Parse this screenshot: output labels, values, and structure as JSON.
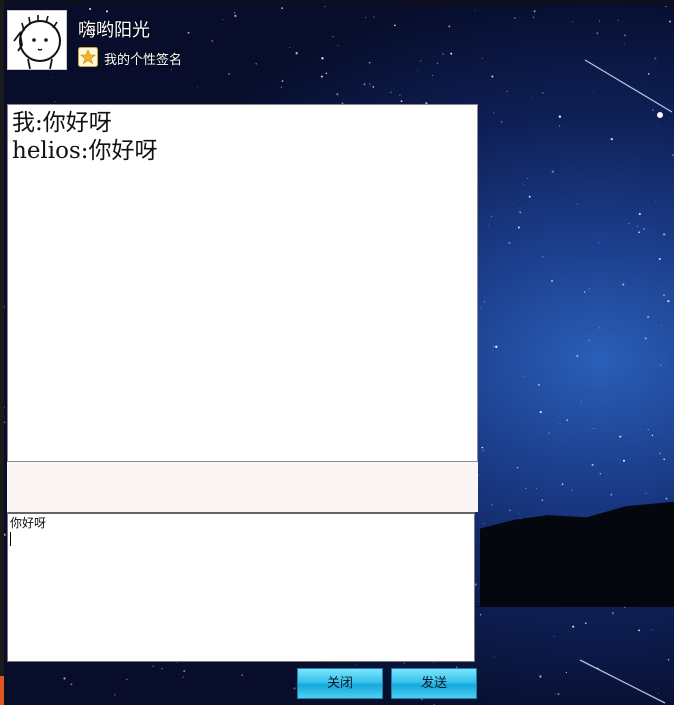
{
  "header": {
    "nickname": "嗨哟阳光",
    "signature": "我的个性签名",
    "avatar_icon": "cartoon-avatar-icon",
    "signature_icon": "star-icon"
  },
  "chat": {
    "messages": [
      {
        "sender": "我",
        "text": "你好呀",
        "line": "我:你好呀"
      },
      {
        "sender": "helios",
        "text": "你好呀",
        "line": "helios:你好呀"
      }
    ]
  },
  "composer": {
    "value": "你好呀"
  },
  "buttons": {
    "close_label": "关闭",
    "send_label": "发送"
  },
  "colors": {
    "button_accent": "#35c3ee",
    "toolbar_bg": "#fbf6f5",
    "sky_dark": "#070d2a",
    "sky_light": "#2a5fb8"
  }
}
